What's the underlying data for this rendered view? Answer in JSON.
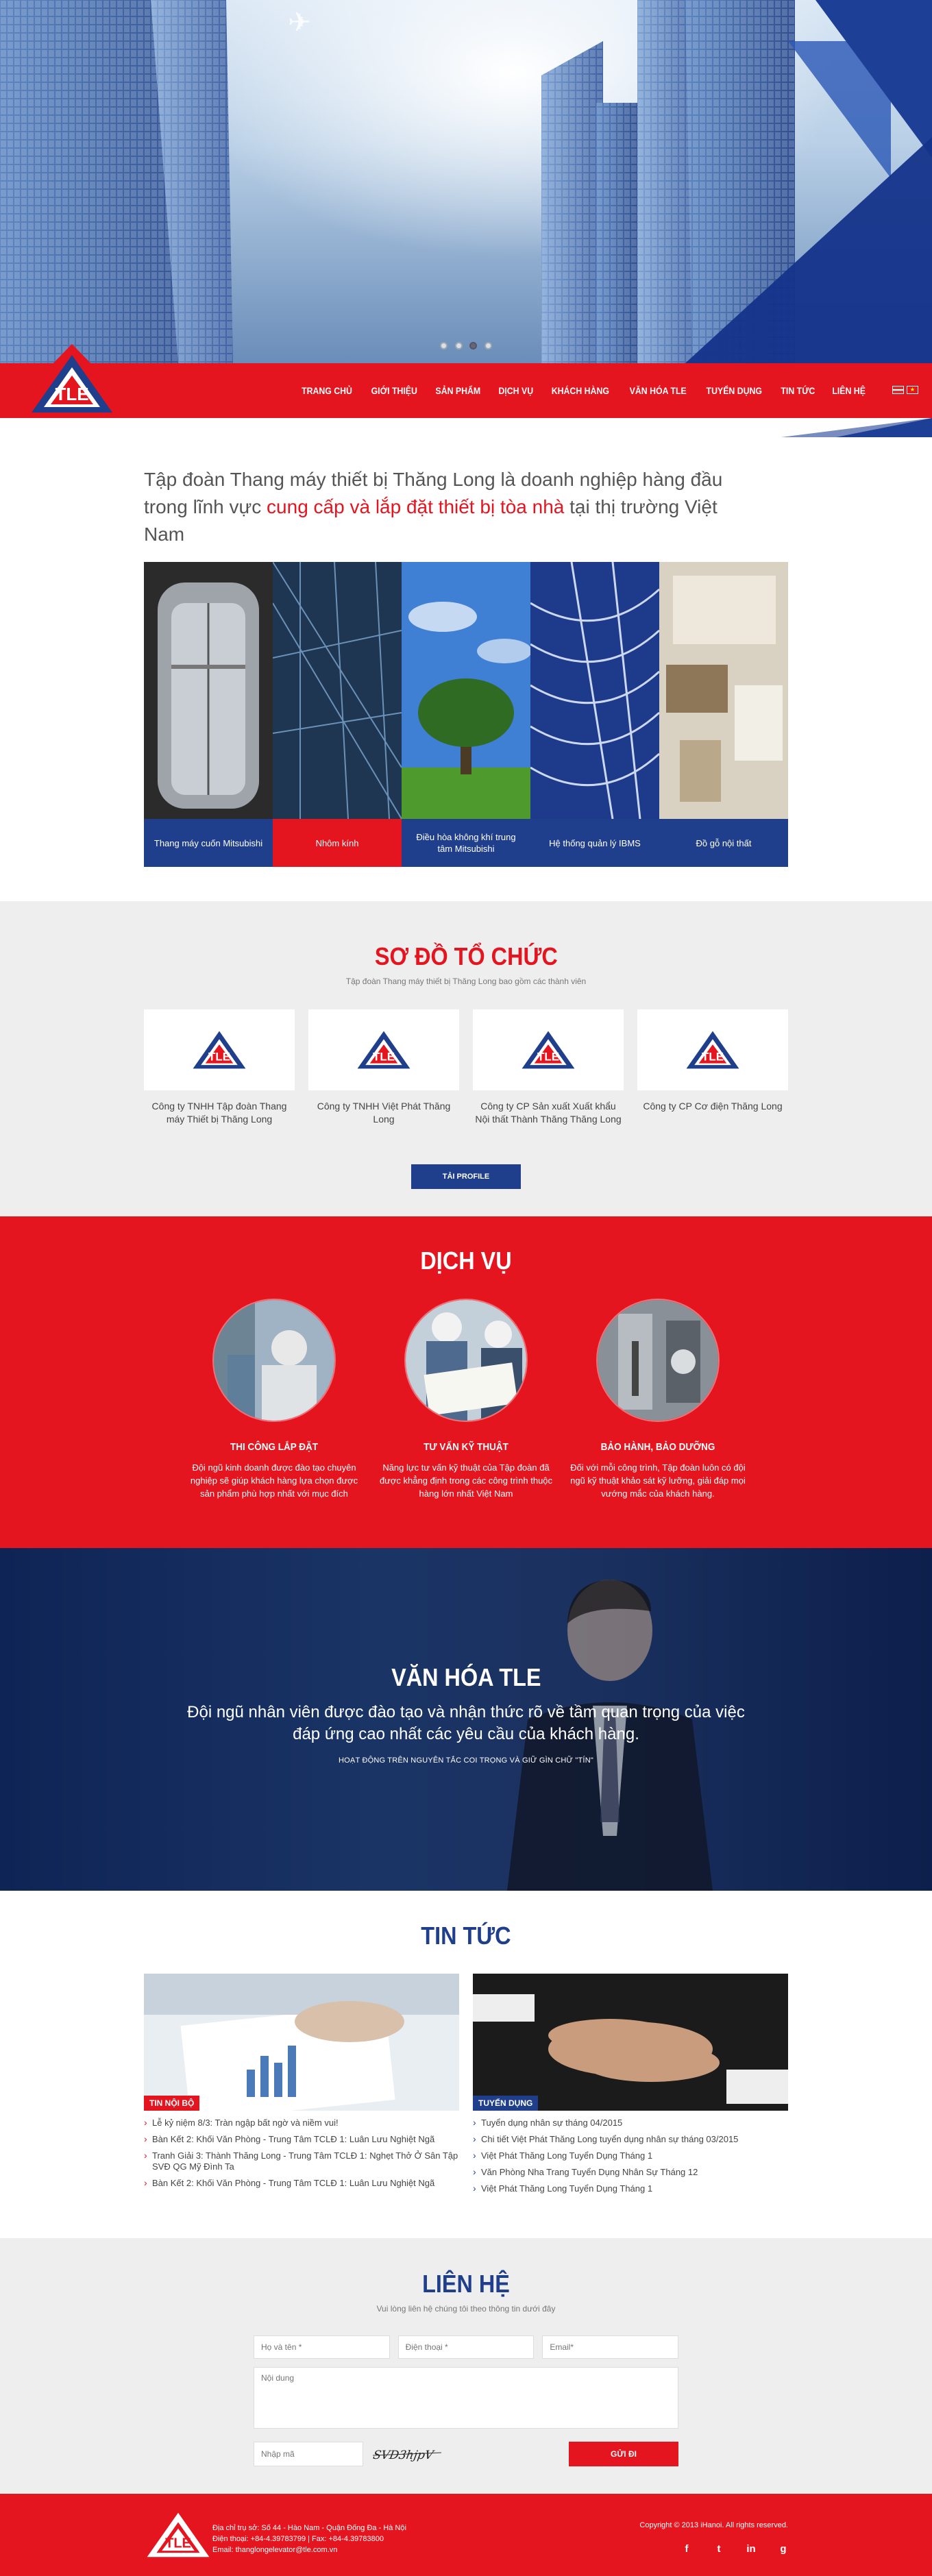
{
  "nav": {
    "items": [
      "TRANG CHỦ",
      "GIỚI THIỆU",
      "SẢN PHẨM",
      "DỊCH VỤ",
      "KHÁCH HÀNG",
      "VĂN HÓA TLE",
      "TUYỂN DỤNG",
      "TIN TỨC",
      "LIÊN HỆ"
    ],
    "logo_text": "TLE"
  },
  "intro": {
    "text_before": "Tập đoàn Thang máy thiết bị Thăng Long là doanh nghiệp hàng đầu trong lĩnh vực ",
    "highlight": "cung cấp và lắp đặt thiết bị tòa nhà",
    "text_after": " tại thị trường Việt Nam",
    "highlight_color": "#e5151f"
  },
  "products": [
    {
      "label": "Thang máy cuốn Mitsubishi",
      "active": false
    },
    {
      "label": "Nhôm kính",
      "active": true
    },
    {
      "label": "Điều hòa không khí trung tâm Mitsubishi",
      "active": false
    },
    {
      "label": "Hệ thống quản lý IBMS",
      "active": false
    },
    {
      "label": "Đồ gỗ nội thất",
      "active": false
    }
  ],
  "org": {
    "title": "SƠ ĐỒ TỔ CHỨC",
    "subtitle": "Tập đoàn Thang máy thiết bị Thăng Long bao gồm các thành viên",
    "companies": [
      "Công ty TNHH Tập đoàn Thang máy Thiết bị Thăng Long",
      "Công ty TNHH Việt Phát Thăng Long",
      "Công ty CP Sản xuất Xuất khẩu Nội thất Thành Thăng Thăng Long",
      "Công ty CP Cơ điện Thăng Long"
    ],
    "button": "TẢI PROFILE"
  },
  "services": {
    "title": "DỊCH VỤ",
    "items": [
      {
        "title": "THI CÔNG LẮP ĐẶT",
        "desc": "Đội ngũ kinh doanh được đào tạo chuyên nghiệp sẽ giúp khách hàng lựa chọn được sản phẩm phù hợp nhất với mục đích"
      },
      {
        "title": "TƯ VẤN KỸ THUẬT",
        "desc": "Năng lực tư vấn kỹ thuật của Tập đoàn đã được khẳng định trong các công trình thuộc hàng lớn nhất Việt Nam"
      },
      {
        "title": "BẢO HÀNH, BẢO DƯỠNG",
        "desc": "Đối với mỗi công trình, Tập đoàn luôn có đội ngũ kỹ thuật khảo sát kỹ lưỡng, giải đáp mọi vướng mắc của khách hàng."
      }
    ]
  },
  "culture": {
    "title": "VĂN HÓA TLE",
    "line1": "Đội ngũ nhân viên được đào tạo và nhận thức rõ về tầm quan trọng của việc",
    "line2": "đáp ứng cao nhất các yêu cầu của khách hàng.",
    "small": "HOẠT ĐỘNG TRÊN NGUYÊN TẮC COI TRỌNG VÀ GIỮ GÌN CHỮ \"TÍN\""
  },
  "news": {
    "title": "TIN TỨC",
    "columns": [
      {
        "tag": "TIN NỘI BỘ",
        "items": [
          "Lễ kỷ niệm 8/3: Tràn ngập bất ngờ và niềm vui!",
          "Bàn Kết 2: Khối Văn Phòng - Trung Tâm TCLĐ 1: Luân Lưu Nghiệt Ngã",
          "Tranh Giải 3: Thành Thăng Long - Trung Tâm TCLĐ 1: Nghẹt Thở Ở Sân Tập SVĐ QG Mỹ Đình Ta",
          "Bàn Kết 2: Khối Văn Phòng - Trung Tâm TCLĐ 1: Luân Lưu Nghiệt Ngã"
        ]
      },
      {
        "tag": "TUYỂN DỤNG",
        "items": [
          "Tuyển dụng nhân sự tháng 04/2015",
          "Chi tiết Việt Phát Thăng Long tuyển dụng nhân sự tháng 03/2015",
          "Việt Phát Thăng Long Tuyển Dụng Tháng 1",
          "Văn Phòng Nha Trang Tuyển Dụng Nhân Sự Tháng 12",
          "Việt Phát Thăng Long Tuyển Dụng Tháng 1"
        ]
      }
    ]
  },
  "contact": {
    "title": "LIÊN HỆ",
    "subtitle": "Vui lòng liên hệ chúng tôi theo thông tin dưới đây",
    "name_ph": "Họ và tên *",
    "phone_ph": "Điện thoại *",
    "email_ph": "Email*",
    "content_ph": "Nội dung",
    "captcha_ph": "Nhập mã",
    "captcha_text": "SVD3hjpV",
    "send": "GỬI ĐI"
  },
  "footer": {
    "address": "Địa chỉ trụ sở: Số 44 - Hào Nam - Quận Đống Đa - Hà Nội",
    "phone": "Điện thoại: +84-4.39783799  |  Fax: +84-4.39783800",
    "email": "Email: thanglongelevator@tle.com.vn",
    "copyright": "Copyright © 2013 iHanoi. All rights reserved.",
    "social": [
      "f",
      "t",
      "in",
      "g"
    ]
  }
}
